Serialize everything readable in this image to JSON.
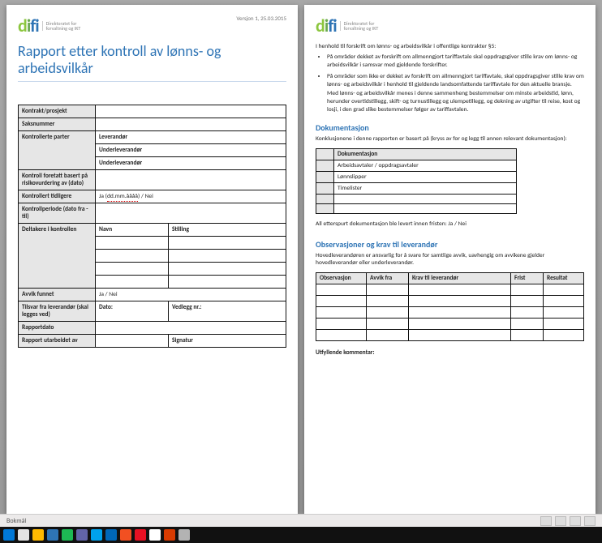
{
  "logo": {
    "sub1": "Direktoratet for",
    "sub2": "forvaltning og IKT"
  },
  "page1": {
    "version": "Versjon 1, 25.03.2015",
    "title": "Rapport etter kontroll av lønns- og arbeidsvilkår",
    "rows": {
      "kontrakt": "Kontrakt/prosjekt",
      "saksnummer": "Saksnummer",
      "kontrollerte": "Kontrollerte parter",
      "leverandor": "Leverandør",
      "underlev1": "Underleverandør",
      "underlev2": "Underleverandør",
      "kontrollforetatt": "Kontroll foretatt basert på risikovurdering av (dato)",
      "kontrollerttidl": "Kontrollert tidligere",
      "kontrollerttidl_val_pre": "Ja (",
      "kontrollerttidl_val_mid": "dd.mm.åååå",
      "kontrollerttidl_val_post": ") / Nei",
      "kontrollperiode": "Kontrollperiode (dato fra - til)",
      "deltakere": "Deltakere i kontrollen",
      "navn": "Navn",
      "stilling": "Stilling",
      "avvik": "Avvik funnet",
      "avvik_val": "Ja / Nei",
      "tilsvar": "Tilsvar fra leverandør (skal legges ved)",
      "dato": "Dato:",
      "vedlegg": "Vedlegg nr.:",
      "rapportdato": "Rapportdato",
      "rapportutarb": "Rapport utarbeidet av",
      "signatur": "Signatur"
    }
  },
  "page2": {
    "intro": "I henhold til forskrift om lønns- og arbeidsvilkår i offentlige kontrakter §5:",
    "bullets": [
      "På områder dekket av forskrift om allmenngjort tariffavtale skal oppdragsgiver stille krav om lønns- og arbeidsvilkår i samsvar med gjeldende forskrifter.",
      "På områder som ikke er dekket av forskrift om allmenngjort tariffavtale, skal oppdragsgiver stille krav om lønns- og arbeidsvilkår i henhold til gjeldende landsomfattende tariffavtale for den aktuelle bransje. Med lønns- og arbeidsvilkår menes i denne sammenheng bestemmelser om minste arbeidstid, lønn, herunder overtidstillegg, skift- og turnustillegg og ulempetillegg, og dekning av utgifter til reise, kost og losji, i den grad slike bestemmelser følger av tariffavtalen."
    ],
    "sec_dok": "Dokumentasjon",
    "dok_para": "Konklusjonene i denne rapporten er basert på (kryss av for og legg til annen relevant dokumentasjon):",
    "dok_header": "Dokumentasjon",
    "dok_rows": [
      "Arbeidsavtaler / oppdragsavtaler",
      "Lønnslipper",
      "Timelister",
      "",
      ""
    ],
    "etterspurt": "All etterspurt dokumentasjon ble levert innen fristen: Ja / Nei",
    "sec_obs": "Observasjoner og krav til leverandør",
    "obs_para": "Hovedleverandøren er ansvarlig for å svare for samtlige avvik, uavhengig om avvikene gjelder hovedleverandør eller underleverandør.",
    "obs_headers": [
      "Observasjon",
      "Avvik fra",
      "Krav til leverandør",
      "Frist",
      "Resultat"
    ],
    "utfyllende": "Utfyllende kommentar:"
  },
  "statusbar": {
    "lang": "Bokmål"
  },
  "taskbar_colors": [
    "#0078d7",
    "#e3e3e3",
    "#ffb900",
    "#2e74b5",
    "#1db954",
    "#6264a7",
    "#00a2ed",
    "#0067b8",
    "#f25022",
    "#e81123",
    "#ffffff",
    "#d83b01",
    "#b3b3b3"
  ]
}
